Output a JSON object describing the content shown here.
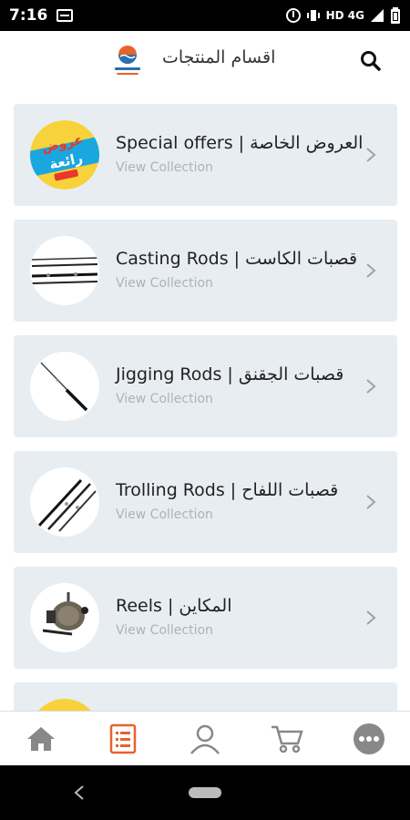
{
  "status_bar": {
    "time": "7:16",
    "network": "HD 4G"
  },
  "header": {
    "title": "اقسام المنتجات"
  },
  "categories": [
    {
      "title": "Special offers | العروض الخاصة",
      "subtitle": "View Collection",
      "thumb_text_1": "عروض",
      "thumb_text_2": "رائعة",
      "thumb_tag": ""
    },
    {
      "title": "Casting Rods | قصبات الكاست",
      "subtitle": "View Collection"
    },
    {
      "title": "Jigging Rods | قصبات الجقنق",
      "subtitle": "View Collection"
    },
    {
      "title": "Trolling Rods | قصبات اللفاح",
      "subtitle": "View Collection"
    },
    {
      "title": "Reels | المكاين",
      "subtitle": "View Collection"
    }
  ],
  "bottom_nav": [
    "home-icon",
    "catalog-list-icon",
    "account-icon",
    "cart-icon",
    "more-icon"
  ],
  "colors": {
    "accent": "#e8622c",
    "card_bg": "#e8edf2",
    "nav_icon": "#888888"
  }
}
